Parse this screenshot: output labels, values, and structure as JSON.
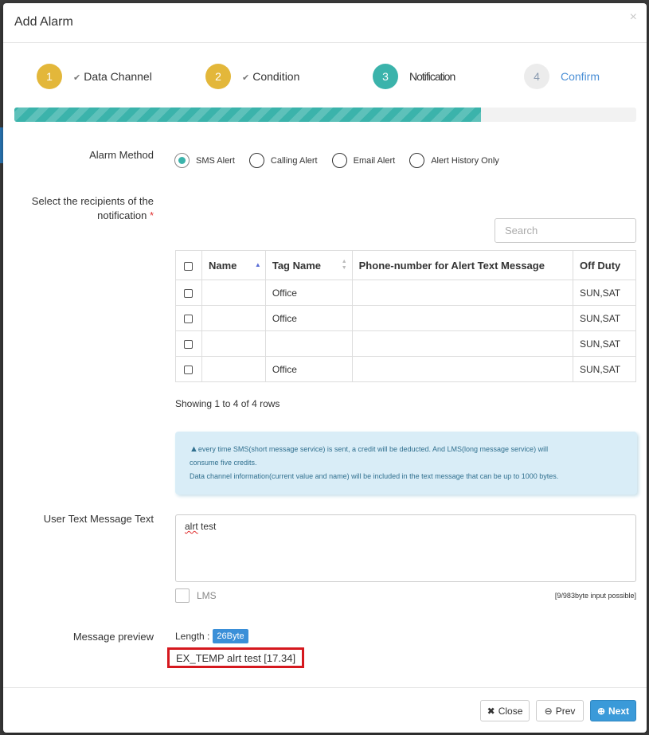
{
  "dialog": {
    "title": "Add Alarm",
    "close_symbol": "×"
  },
  "steps": [
    {
      "number": "1",
      "label": "Data Channel",
      "status": "done"
    },
    {
      "number": "2",
      "label": "Condition",
      "status": "done"
    },
    {
      "number": "3",
      "label": "Notification",
      "status": "active"
    },
    {
      "number": "4",
      "label": "Confirm",
      "status": "pending"
    }
  ],
  "progress": {
    "fraction": 0.75,
    "color": "#3bb3ab"
  },
  "alarm_method": {
    "label": "Alarm Method",
    "options": [
      {
        "label": "SMS Alert",
        "selected": true
      },
      {
        "label": "Calling Alert",
        "selected": false
      },
      {
        "label": "Email Alert",
        "selected": false
      },
      {
        "label": "Alert History Only",
        "selected": false
      }
    ]
  },
  "recipients": {
    "label_line1": "Select the recipients of the",
    "label_line2": "notification",
    "required_mark": "*",
    "search_placeholder": "Search",
    "columns": [
      "Name",
      "Tag Name",
      "Phone-number for Alert Text Message",
      "Off Duty"
    ],
    "rows": [
      {
        "name": "",
        "tag": "Office",
        "phone": "",
        "off_duty": "SUN,SAT"
      },
      {
        "name": "",
        "tag": "Office",
        "phone": "",
        "off_duty": "SUN,SAT"
      },
      {
        "name": "",
        "tag": "",
        "phone": "",
        "off_duty": "SUN,SAT"
      },
      {
        "name": "",
        "tag": "Office",
        "phone": "",
        "off_duty": "SUN,SAT"
      }
    ],
    "rows_info": "Showing 1 to 4 of 4 rows"
  },
  "notice": {
    "line1": "every time SMS(short message service) is sent, a credit will be deducted. And LMS(long message service) will",
    "line2": "consume five credits.",
    "line3": "Data channel information(current value and name) will be included in the text message that can be up to 1000 bytes."
  },
  "user_text": {
    "label": "User Text Message Text",
    "word1": "alrt",
    "word2": " test",
    "lms_label": "LMS",
    "byte_info": "[9/983byte input possible]"
  },
  "preview": {
    "label": "Message preview",
    "length_label": "Length :",
    "length_value": "26Byte",
    "text": "EX_TEMP alrt test [17.34]"
  },
  "footer": {
    "close_label": "Close",
    "prev_label": "Prev",
    "next_label": "Next"
  }
}
